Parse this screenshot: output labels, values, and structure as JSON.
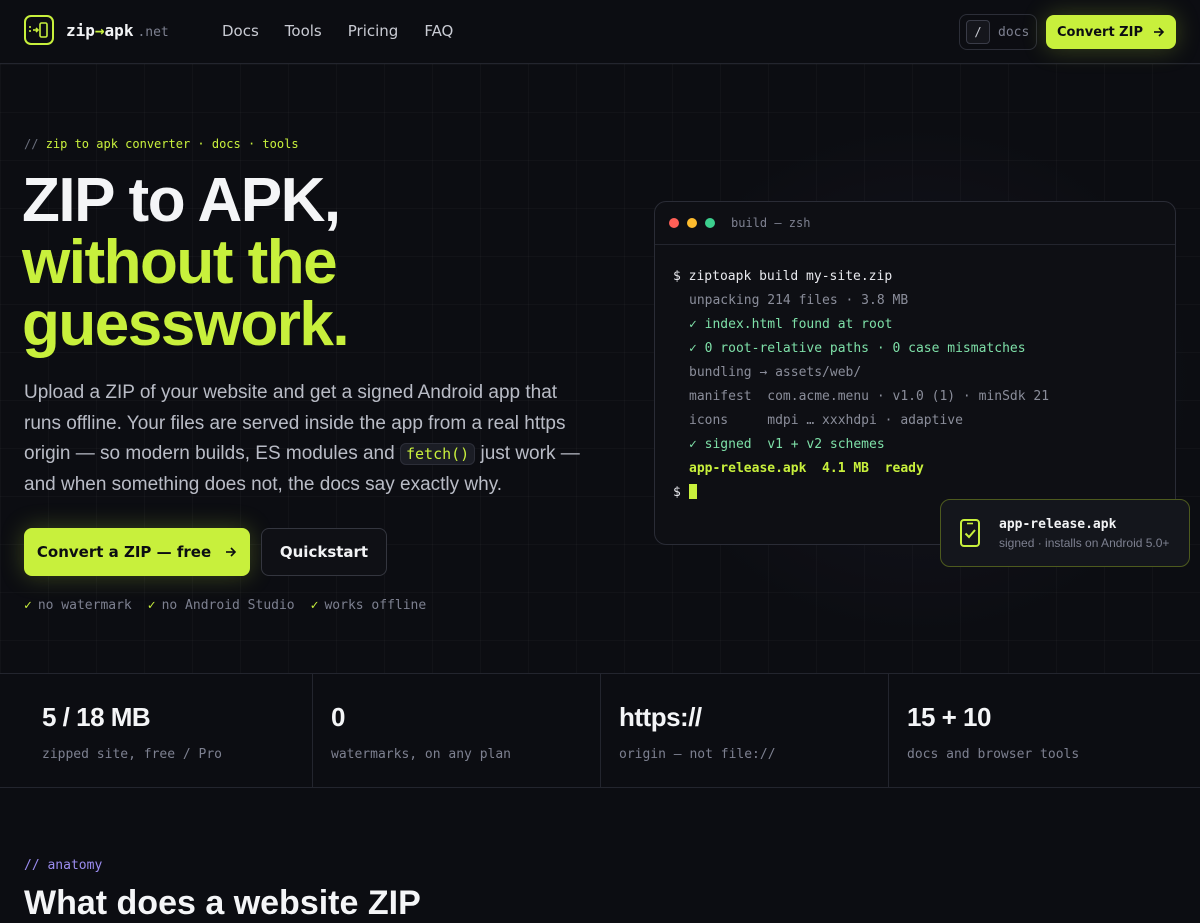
{
  "brand": {
    "name_a": "zip",
    "arrow": "→",
    "name_b": "apk",
    "tld": ".net"
  },
  "nav": {
    "links": [
      "Docs",
      "Tools",
      "Pricing",
      "FAQ"
    ],
    "search_key": "/",
    "search_label": "docs",
    "cta": "Convert ZIP"
  },
  "hero": {
    "eyebrow_prefix": "//",
    "eyebrow": "zip to apk converter · docs · tools",
    "title_line1": "ZIP to APK,",
    "title_line2": "without the",
    "title_line3": "guesswork.",
    "lead_a": "Upload a ZIP of your website and get a signed Android app that runs offline. Your files are served inside the app from a real https origin — so modern builds, ES modules and ",
    "lead_code": "fetch()",
    "lead_b": " just work — and when something does not, the docs say exactly why.",
    "cta_primary": "Convert a ZIP — free",
    "cta_secondary": "Quickstart",
    "checks": [
      "no watermark",
      "no Android Studio",
      "works offline"
    ]
  },
  "terminal": {
    "title": "build — zsh",
    "prompt": "$",
    "command": "ziptoapk build my-site.zip",
    "lines": [
      "unpacking 214 files · 3.8 MB",
      "✓ index.html found at root",
      "✓ 0 root-relative paths · 0 case mismatches",
      "bundling → assets/web/",
      "manifest  com.acme.menu · v1.0 (1) · minSdk 21",
      "icons     mdpi … xxxhdpi · adaptive",
      "✓ signed  v1 + v2 schemes",
      "app-release.apk  4.1 MB  ready"
    ],
    "final_prompt": "$"
  },
  "toast": {
    "title": "app-release.apk",
    "subtitle": "signed · installs on Android 5.0+"
  },
  "stats": [
    {
      "value": "5 / 18 MB",
      "label": "zipped site, free / Pro"
    },
    {
      "value": "0",
      "label": "watermarks, on any plan"
    },
    {
      "value": "https://",
      "label": "origin — not file://"
    },
    {
      "value": "15 + 10",
      "label": "docs and browser tools"
    }
  ],
  "anatomy": {
    "eyebrow": "// anatomy",
    "title": "What does a website ZIP"
  },
  "colors": {
    "accent": "#c8f03c",
    "bg": "#0c0d12",
    "ok": "#7ee0a8",
    "purple": "#9b8cf0"
  },
  "icons": {
    "logo": "phone-arrow-icon",
    "arrow": "arrow-right-icon",
    "toast": "phone-check-icon"
  }
}
